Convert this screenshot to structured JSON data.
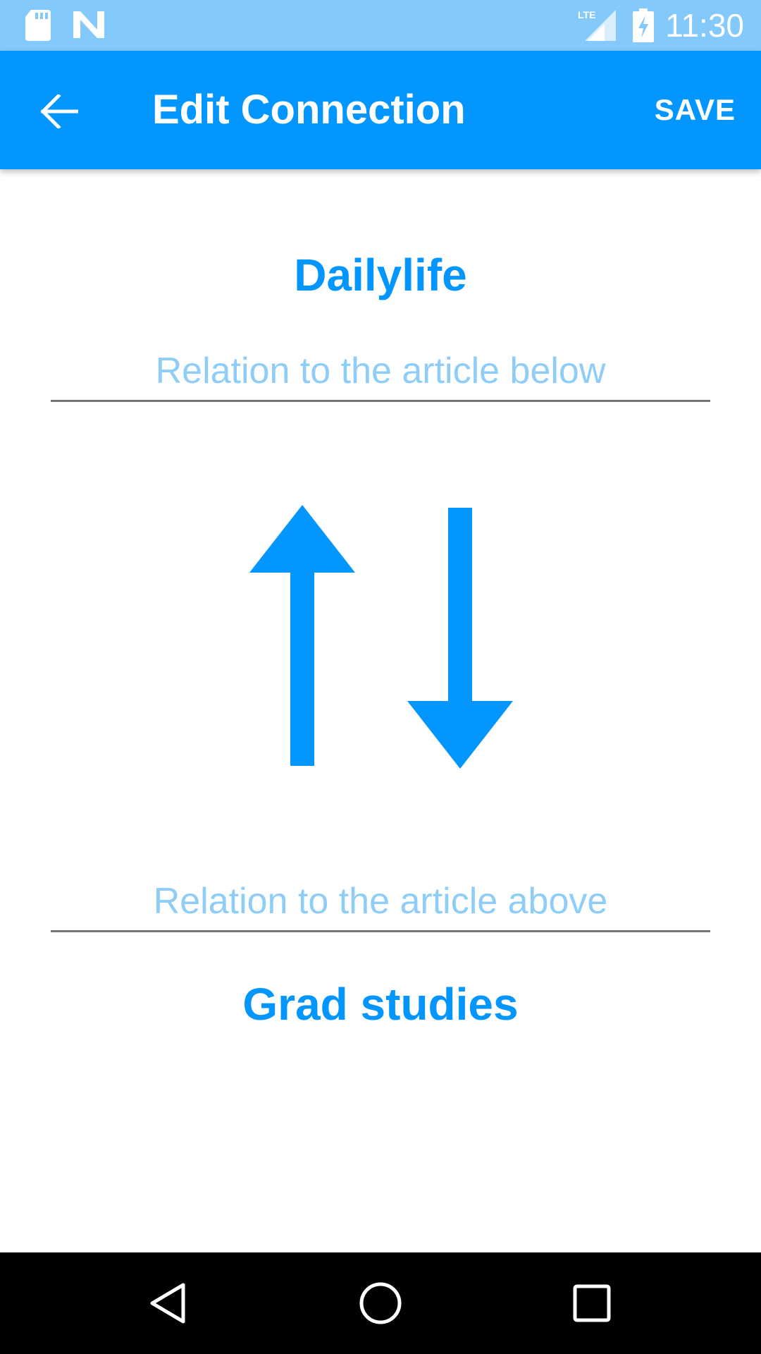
{
  "status_bar": {
    "time": "11:30",
    "network": "LTE",
    "icons": [
      "sd-card-icon",
      "n-logo-icon",
      "lte-signal-icon",
      "battery-charging-icon"
    ]
  },
  "app_bar": {
    "title": "Edit Connection",
    "save_label": "SAVE",
    "back_icon": "arrow-back-icon"
  },
  "connection": {
    "top_article": "Dailylife",
    "relation_below": {
      "placeholder": "Relation to the article below",
      "value": ""
    },
    "relation_above": {
      "placeholder": "Relation to the article above",
      "value": ""
    },
    "bottom_article": "Grad studies"
  },
  "nav_bar": {
    "icons": [
      "back-triangle-icon",
      "home-circle-icon",
      "recents-square-icon"
    ]
  },
  "colors": {
    "primary": "#0396ff",
    "status_bar": "#84c9fb",
    "hint": "#8fcdf9",
    "underline": "#757575"
  }
}
